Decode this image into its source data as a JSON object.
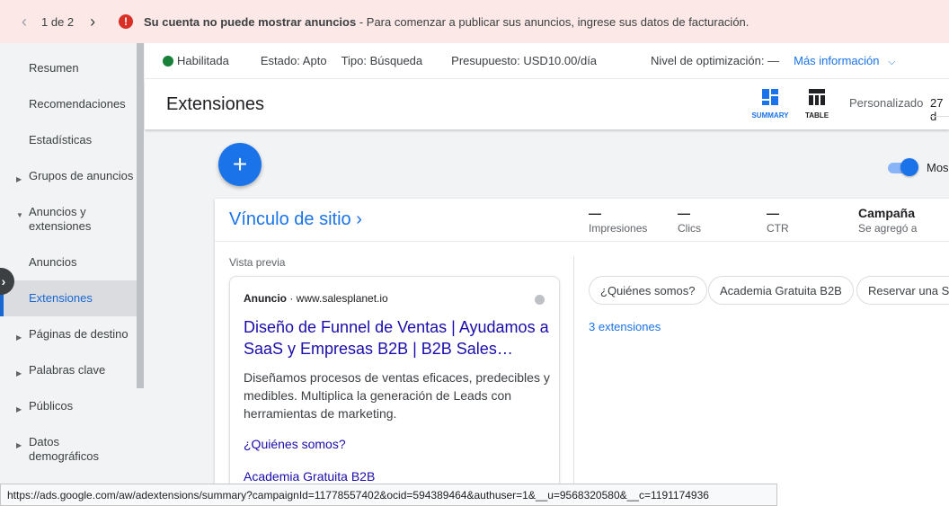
{
  "banner": {
    "pager": "1 de 2",
    "prev_icon": "chevron-left-icon",
    "next_icon": "chevron-right-icon",
    "alert_icon": "alert-icon",
    "alert_glyph": "!",
    "alert_bold": "Su cuenta no puede mostrar anuncios",
    "alert_rest": " - Para comenzar a publicar sus anuncios, ingrese sus datos de facturación."
  },
  "sidebar": {
    "items": [
      {
        "label": "Resumen"
      },
      {
        "label": "Recomendaciones"
      },
      {
        "label": "Estadísticas"
      },
      {
        "label": "Grupos de anuncios"
      },
      {
        "label": "Anuncios y extensiones"
      },
      {
        "label": "Anuncios"
      },
      {
        "label": "Extensiones"
      },
      {
        "label": "Páginas de destino"
      },
      {
        "label": "Palabras clave"
      },
      {
        "label": "Públicos"
      },
      {
        "label": "Datos demográficos"
      }
    ]
  },
  "status": {
    "enabled": "Habilitada",
    "estado": "Estado: Apto",
    "tipo": "Tipo: Búsqueda",
    "presupuesto": "Presupuesto: USD10.00/día",
    "optimizacion": "Nivel de optimización: —",
    "mas_info": "Más información"
  },
  "header": {
    "title": "Extensiones",
    "summary_label": "SUMMARY",
    "table_label": "TABLE",
    "personalizado": "Personalizado",
    "date_partial": "27 d",
    "toggle_label": "Mos"
  },
  "card": {
    "title": "Vínculo de sitio",
    "metrics": [
      {
        "value": "—",
        "label": "Impresiones"
      },
      {
        "value": "—",
        "label": "Clics"
      },
      {
        "value": "—",
        "label": "CTR"
      },
      {
        "value": "Campaña",
        "label": "Se agregó a"
      }
    ],
    "preview_label": "Vista previa",
    "ad": {
      "badge": "Anuncio",
      "domain": " · www.salesplanet.io",
      "headline": "Diseño de Funnel de Ventas | Ayudamos a SaaS y Empresas B2B | B2B Sales…",
      "description": "Diseñamos procesos de ventas eficaces, predecibles y medibles. Multiplica la generación de Leads con herramientas de marketing.",
      "links": [
        "¿Quiénes somos?",
        "Academia Gratuita B2B"
      ]
    },
    "chips": [
      "¿Quiénes somos?",
      "Academia Gratuita B2B",
      "Reservar una Se"
    ],
    "extensions_link": "3 extensiones"
  },
  "statusbar_url": "https://ads.google.com/aw/adextensions/summary?campaignId=11778557402&ocid=594389464&authuser=1&__u=9568320580&__c=1191174936",
  "colors": {
    "accent": "#1a73e8",
    "alert": "#d93025",
    "banner_bg": "#fce8e6",
    "enabled": "#188038"
  }
}
